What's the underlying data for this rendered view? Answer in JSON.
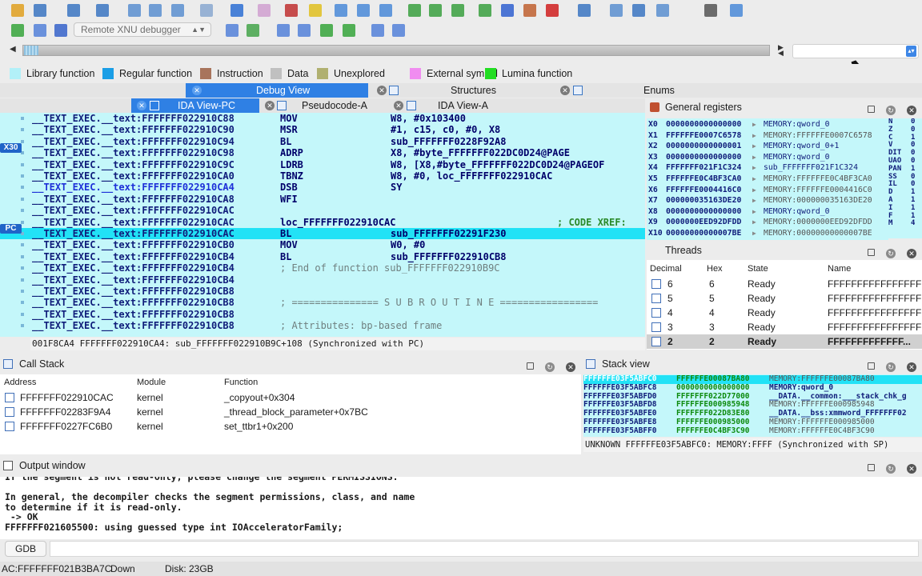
{
  "toolbar": {
    "debugger_select": "Remote XNU debugger",
    "icons_row1": [
      "open-icon",
      "save-icon",
      "back-icon",
      "forward-icon",
      "copy-icon",
      "paste-icon",
      "find-icon",
      "search-icon",
      "down-arrow-icon",
      "text-icon",
      "image-icon",
      "search-text-icon",
      "graph-icon",
      "hex-icon",
      "structures-icon",
      "function-icon",
      "add-icon",
      "bookmark-icon",
      "delete-icon",
      "stop-icon",
      "chart-icon",
      "script-icon",
      "plugin-icon",
      "window-icon",
      "more-icon",
      "layout-icon",
      "folder-icon",
      "tools-icon"
    ],
    "icons_row2": [
      "play-icon",
      "pause-icon",
      "stop-debug-icon",
      "attach-icon",
      "detach-icon",
      "step-into-icon",
      "step-over-icon",
      "run-to-cursor-icon",
      "step-out-icon",
      "breakpoints-icon",
      "tracing-icon"
    ]
  },
  "legend": [
    {
      "label": "Library function",
      "color": "#b2f0f8"
    },
    {
      "label": "Regular function",
      "color": "#1a9ee6"
    },
    {
      "label": "Instruction",
      "color": "#a8745c"
    },
    {
      "label": "Data",
      "color": "#c0c0c0"
    },
    {
      "label": "Unexplored",
      "color": "#b0b070"
    },
    {
      "label": "External symbol",
      "color": "#f08cf0"
    },
    {
      "label": "Lumina function",
      "color": "#22dd22"
    }
  ],
  "tabs": {
    "row1": [
      {
        "label": "Debug View",
        "active": true
      },
      {
        "label": "Structures",
        "active": false
      },
      {
        "label": "Enums",
        "active": false
      }
    ],
    "row2": [
      {
        "label": "IDA View-PC",
        "active": true
      },
      {
        "label": "Pseudocode-A",
        "active": false
      },
      {
        "label": "IDA View-A",
        "active": false
      }
    ]
  },
  "disasm": {
    "lines": [
      {
        "seg": "__TEXT_EXEC.__text:FFFFFFF022910C88",
        "mn": "MOV",
        "op": "W8, #0x103400",
        "type": "code"
      },
      {
        "seg": "__TEXT_EXEC.__text:FFFFFFF022910C90",
        "mn": "MSR",
        "op": "#1, c15, c0, #0, X8",
        "type": "code"
      },
      {
        "seg": "__TEXT_EXEC.__text:FFFFFFF022910C94",
        "mn": "BL",
        "op": "sub_FFFFFFF0228F92A8",
        "type": "code"
      },
      {
        "seg": "__TEXT_EXEC.__text:FFFFFFF022910C98",
        "mn": "ADRP",
        "op": "X8, #byte_FFFFFFF022DC0D24@PAGE",
        "type": "code"
      },
      {
        "seg": "__TEXT_EXEC.__text:FFFFFFF022910C9C",
        "mn": "LDRB",
        "op": "W8, [X8,#byte_FFFFFFF022DC0D24@PAGEOF",
        "type": "code"
      },
      {
        "seg": "__TEXT_EXEC.__text:FFFFFFF022910CA0",
        "mn": "TBNZ",
        "op": "W8, #0, loc_FFFFFFF022910CAC",
        "type": "code"
      },
      {
        "seg": "__TEXT_EXEC.__text:FFFFFFF022910CA4",
        "mn": "DSB",
        "op": "SY",
        "type": "cur"
      },
      {
        "seg": "__TEXT_EXEC.__text:FFFFFFF022910CA8",
        "mn": "WFI",
        "op": "",
        "type": "code"
      },
      {
        "seg": "__TEXT_EXEC.__text:FFFFFFF022910CAC",
        "mn": "",
        "op": "",
        "type": "code"
      },
      {
        "seg": "__TEXT_EXEC.__text:FFFFFFF022910CAC",
        "mn": "loc_FFFFFFF022910CAC",
        "op": "",
        "xref": "; CODE XREF:",
        "type": "label"
      },
      {
        "seg": "__TEXT_EXEC.__text:FFFFFFF022910CAC",
        "mn": "BL",
        "op": "sub_FFFFFFF02291F230",
        "type": "pc"
      },
      {
        "seg": "__TEXT_EXEC.__text:FFFFFFF022910CB0",
        "mn": "MOV",
        "op": "W0, #0",
        "type": "code"
      },
      {
        "seg": "__TEXT_EXEC.__text:FFFFFFF022910CB4",
        "mn": "BL",
        "op": "sub_FFFFFFF022910CB8",
        "type": "code"
      },
      {
        "seg": "__TEXT_EXEC.__text:FFFFFFF022910CB4",
        "cm": "; End of function sub_FFFFFFF022910B9C",
        "type": "comment"
      },
      {
        "seg": "__TEXT_EXEC.__text:FFFFFFF022910CB4",
        "type": "code"
      },
      {
        "seg": "__TEXT_EXEC.__text:FFFFFFF022910CB8",
        "type": "code"
      },
      {
        "seg": "__TEXT_EXEC.__text:FFFFFFF022910CB8",
        "cm": "; =============== S U B R O U T I N E =================",
        "type": "comment"
      },
      {
        "seg": "__TEXT_EXEC.__text:FFFFFFF022910CB8",
        "type": "code"
      },
      {
        "seg": "__TEXT_EXEC.__text:FFFFFFF022910CB8",
        "cm": "; Attributes: bp-based frame",
        "type": "comment"
      }
    ],
    "markers": {
      "x30": "X30",
      "pc": "PC"
    },
    "status": "001F8CA4 FFFFFFF022910CA4: sub_FFFFFFF022910B9C+108 (Synchronized with PC)"
  },
  "registers": {
    "title": "General registers",
    "rows": [
      {
        "name": "X0",
        "value": "0000000000000000",
        "deref": "MEMORY:qword_0"
      },
      {
        "name": "X1",
        "value": "FFFFFFE0007C6578",
        "deref": "MEMORY:FFFFFFE0007C6578"
      },
      {
        "name": "X2",
        "value": "0000000000000001",
        "deref": "MEMORY:qword_0+1"
      },
      {
        "name": "X3",
        "value": "0000000000000000",
        "deref": "MEMORY:qword_0"
      },
      {
        "name": "X4",
        "value": "FFFFFFF021F1C324",
        "deref": "sub_FFFFFFF021F1C324"
      },
      {
        "name": "X5",
        "value": "FFFFFFE0C4BF3CA0",
        "deref": "MEMORY:FFFFFFE0C4BF3CA0"
      },
      {
        "name": "X6",
        "value": "FFFFFFE0004416C0",
        "deref": "MEMORY:FFFFFFE0004416C0"
      },
      {
        "name": "X7",
        "value": "000000035163DE20",
        "deref": "MEMORY:000000035163DE20"
      },
      {
        "name": "X8",
        "value": "0000000000000000",
        "deref": "MEMORY:qword_0"
      },
      {
        "name": "X9",
        "value": "0000000EED92DFDD",
        "deref": "MEMORY:0000000EED92DFDD"
      },
      {
        "name": "X10",
        "value": "00000000000007BE",
        "deref": "MEMORY:00000000000007BE"
      }
    ],
    "flags": [
      {
        "name": "N",
        "value": "0"
      },
      {
        "name": "Z",
        "value": "0"
      },
      {
        "name": "C",
        "value": "1"
      },
      {
        "name": "V",
        "value": "0"
      },
      {
        "name": "DIT",
        "value": "0"
      },
      {
        "name": "UAO",
        "value": "0"
      },
      {
        "name": "PAN",
        "value": "1"
      },
      {
        "name": "SS",
        "value": "0"
      },
      {
        "name": "IL",
        "value": "0"
      },
      {
        "name": "D",
        "value": "1"
      },
      {
        "name": "A",
        "value": "1"
      },
      {
        "name": "I",
        "value": "1"
      },
      {
        "name": "F",
        "value": "1"
      },
      {
        "name": "M",
        "value": "4"
      }
    ]
  },
  "threads": {
    "title": "Threads",
    "columns": [
      "Decimal",
      "Hex",
      "State",
      "Name"
    ],
    "rows": [
      {
        "decimal": "6",
        "hex": "6",
        "state": "Ready",
        "name": "FFFFFFFFFFFFFFFF",
        "selected": false
      },
      {
        "decimal": "5",
        "hex": "5",
        "state": "Ready",
        "name": "FFFFFFFFFFFFFFFF",
        "selected": false
      },
      {
        "decimal": "4",
        "hex": "4",
        "state": "Ready",
        "name": "FFFFFFFFFFFFFFFF",
        "selected": false
      },
      {
        "decimal": "3",
        "hex": "3",
        "state": "Ready",
        "name": "FFFFFFFFFFFFFFFF",
        "selected": false
      },
      {
        "decimal": "2",
        "hex": "2",
        "state": "Ready",
        "name": "FFFFFFFFFFFFF...",
        "selected": true
      }
    ]
  },
  "callstack": {
    "title": "Call Stack",
    "columns": [
      "Address",
      "Module",
      "Function"
    ],
    "rows": [
      {
        "address": "FFFFFFF022910CAC",
        "module": "kernel",
        "function": "_copyout+0x304"
      },
      {
        "address": "FFFFFFF02283F9A4",
        "module": "kernel",
        "function": "_thread_block_parameter+0x7BC"
      },
      {
        "address": "FFFFFFF0227FC6B0",
        "module": "kernel",
        "function": "set_ttbr1+0x200"
      }
    ]
  },
  "stackview": {
    "title": "Stack view",
    "rows": [
      {
        "addr": "FFFFFFE03F5ABFC0",
        "val": "FFFFFFE00087BA80",
        "desc": "MEMORY:FFFFFFE00087BA80"
      },
      {
        "addr": "FFFFFFE03F5ABFC8",
        "val": "0000000000000000",
        "desc": "MEMORY:qword_0"
      },
      {
        "addr": "FFFFFFE03F5ABFD0",
        "val": "FFFFFFF022D77000",
        "desc": "__DATA.__common:___stack_chk_g"
      },
      {
        "addr": "FFFFFFE03F5ABFD8",
        "val": "FFFFFFE000985948",
        "desc": "MEMORY:FFFFFFE000985948"
      },
      {
        "addr": "FFFFFFE03F5ABFE0",
        "val": "FFFFFFF022D83E80",
        "desc": "__DATA.__bss:xmmword_FFFFFFF02"
      },
      {
        "addr": "FFFFFFE03F5ABFE8",
        "val": "FFFFFFE000985000",
        "desc": "MEMORY:FFFFFFE000985000"
      },
      {
        "addr": "FFFFFFE03F5ABFF0",
        "val": "FFFFFFE0C4BF3C90",
        "desc": "MEMORY:FFFFFFE0C4BF3C90"
      }
    ],
    "status": "UNKNOWN FFFFFFE03F5ABFC0: MEMORY:FFFF (Synchronized with SP)"
  },
  "output": {
    "title": "Output window",
    "lines": [
      "If the segment is not read-only, please change the segment PERMISSIONS.",
      "",
      "In general, the decompiler checks the segment permissions, class, and name",
      "to determine if it is read-only.",
      " -> OK",
      "FFFFFFF021605500: using guessed type int IOAcceleratorFamily;"
    ],
    "input_label": "GDB"
  },
  "statusbar": {
    "address": "AC:FFFFFFF021B3BA7C",
    "direction": "Down",
    "disk": "Disk: 23GB"
  }
}
